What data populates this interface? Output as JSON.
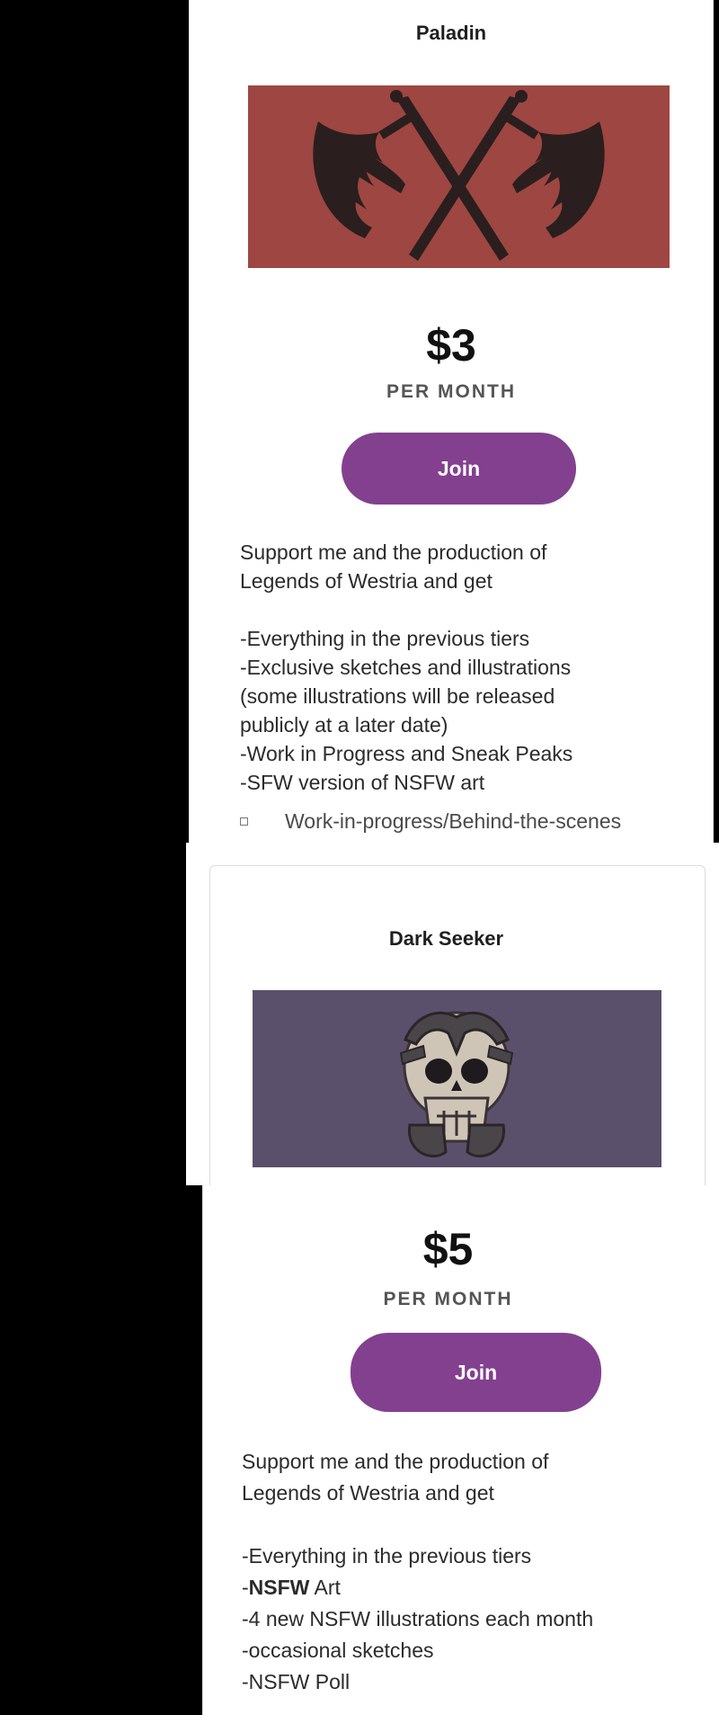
{
  "tiers": [
    {
      "title": "Paladin",
      "price": "$3",
      "period": "PER MONTH",
      "join_label": "Join",
      "banner_color": "#9e4641",
      "icon": "crossed-swords-wings-icon",
      "intro": [
        "Support me and the production of",
        "Legends of Westria and get"
      ],
      "benefits": [
        "-Everything in the previous tiers",
        "-Exclusive sketches and illustrations",
        "(some illustrations will be released",
        "publicly at a later date)",
        "-Work in Progress and Sneak Peaks",
        "-SFW version of NSFW art"
      ],
      "list_item": "Work-in-progress/Behind-the-scenes"
    },
    {
      "title": "Dark Seeker",
      "price": "$5",
      "period": "PER MONTH",
      "join_label": "Join",
      "banner_color": "#5b506c",
      "icon": "skull-hands-icon",
      "intro": [
        "Support me and the production of",
        "Legends of Westria and get"
      ],
      "benefits_line1": "-Everything in the previous tiers",
      "nsfw_prefix": "-",
      "nsfw_bold": "NSFW",
      "nsfw_rest": " Art",
      "benefits_rest": [
        "-4 new NSFW illustrations each month",
        "-occasional sketches",
        "-NSFW Poll"
      ]
    }
  ],
  "colors": {
    "accent": "#83408f",
    "background": "#000000",
    "card": "#ffffff"
  }
}
